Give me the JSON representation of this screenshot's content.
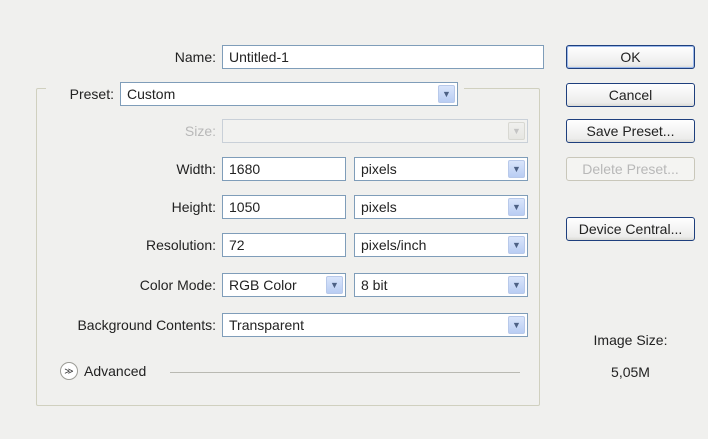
{
  "form": {
    "name": {
      "label": "Name:",
      "value": "Untitled-1"
    },
    "preset": {
      "label": "Preset:",
      "value": "Custom"
    },
    "size": {
      "label": "Size:",
      "value": ""
    },
    "width": {
      "label": "Width:",
      "value": "1680",
      "unit": "pixels"
    },
    "height": {
      "label": "Height:",
      "value": "1050",
      "unit": "pixels"
    },
    "resolution": {
      "label": "Resolution:",
      "value": "72",
      "unit": "pixels/inch"
    },
    "color_mode": {
      "label": "Color Mode:",
      "value": "RGB Color",
      "depth": "8 bit"
    },
    "background": {
      "label": "Background Contents:",
      "value": "Transparent"
    },
    "advanced_label": "Advanced"
  },
  "buttons": {
    "ok": "OK",
    "cancel": "Cancel",
    "save_preset": "Save Preset...",
    "delete_preset": "Delete Preset...",
    "device_central": "Device Central..."
  },
  "image_size": {
    "label": "Image Size:",
    "value": "5,05M"
  },
  "icons": {
    "dropdown": "chevron-down-icon",
    "expand": "double-chevron-down-icon"
  },
  "colors": {
    "field_border": "#7f9db9",
    "button_border": "#1e3f7d",
    "disabled_text": "#b8b8b8"
  }
}
